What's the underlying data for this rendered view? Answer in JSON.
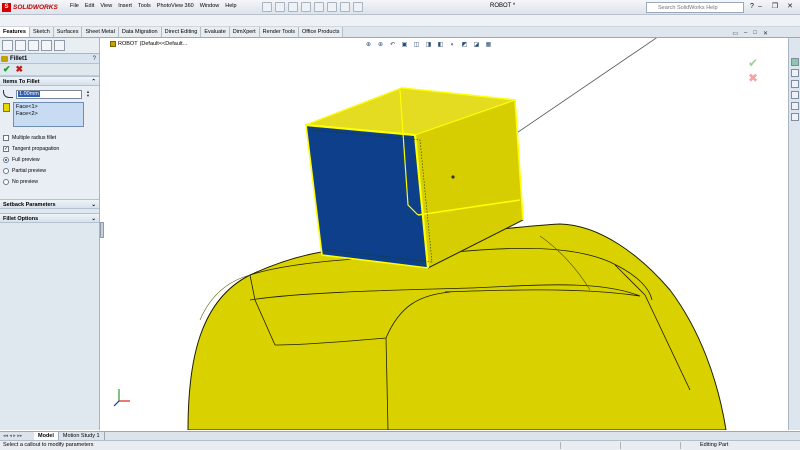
{
  "app": {
    "logo_mark": "S",
    "logo_text": "SOLIDWORKS",
    "doc_title": "ROBOT *"
  },
  "menu": [
    "File",
    "Edit",
    "View",
    "Insert",
    "Tools",
    "PhotoView 360",
    "Window",
    "Help"
  ],
  "search": {
    "placeholder": "Search SolidWorks Help"
  },
  "command_tabs": [
    {
      "label": "Features",
      "active": true
    },
    {
      "label": "Sketch"
    },
    {
      "label": "Surfaces"
    },
    {
      "label": "Sheet Metal"
    },
    {
      "label": "Data Migration"
    },
    {
      "label": "Direct Editing"
    },
    {
      "label": "Evaluate"
    },
    {
      "label": "DimXpert"
    },
    {
      "label": "Render Tools"
    },
    {
      "label": "Office Products"
    }
  ],
  "property_manager": {
    "title": "Fillet1",
    "help": "?",
    "items_group": {
      "header": "Items To Fillet",
      "radius": "1.00mm",
      "faces": [
        "Face<1>",
        "Face<2>"
      ],
      "options": [
        {
          "label": "Multiple radius fillet",
          "checked": false
        },
        {
          "label": "Tangent propagation",
          "checked": true
        }
      ],
      "preview": [
        {
          "label": "Full preview",
          "selected": true
        },
        {
          "label": "Partial preview",
          "selected": false
        },
        {
          "label": "No preview",
          "selected": false
        }
      ]
    },
    "setback_header": "Setback Parameters",
    "fillet_options_header": "Fillet Options"
  },
  "viewport": {
    "breadcrumb_part": "ROBOT",
    "breadcrumb_config": "(Default<<Default..."
  },
  "colors": {
    "part_yellow": "#dcd600",
    "selected_face": "#0d3f8a",
    "highlight": "#ffff00"
  },
  "bottom_tabs": [
    {
      "label": "Model",
      "active": true
    },
    {
      "label": "Motion Study 1",
      "active": false
    }
  ],
  "status": {
    "left": "Select a callout to modify parameters",
    "right": "Editing Part"
  }
}
